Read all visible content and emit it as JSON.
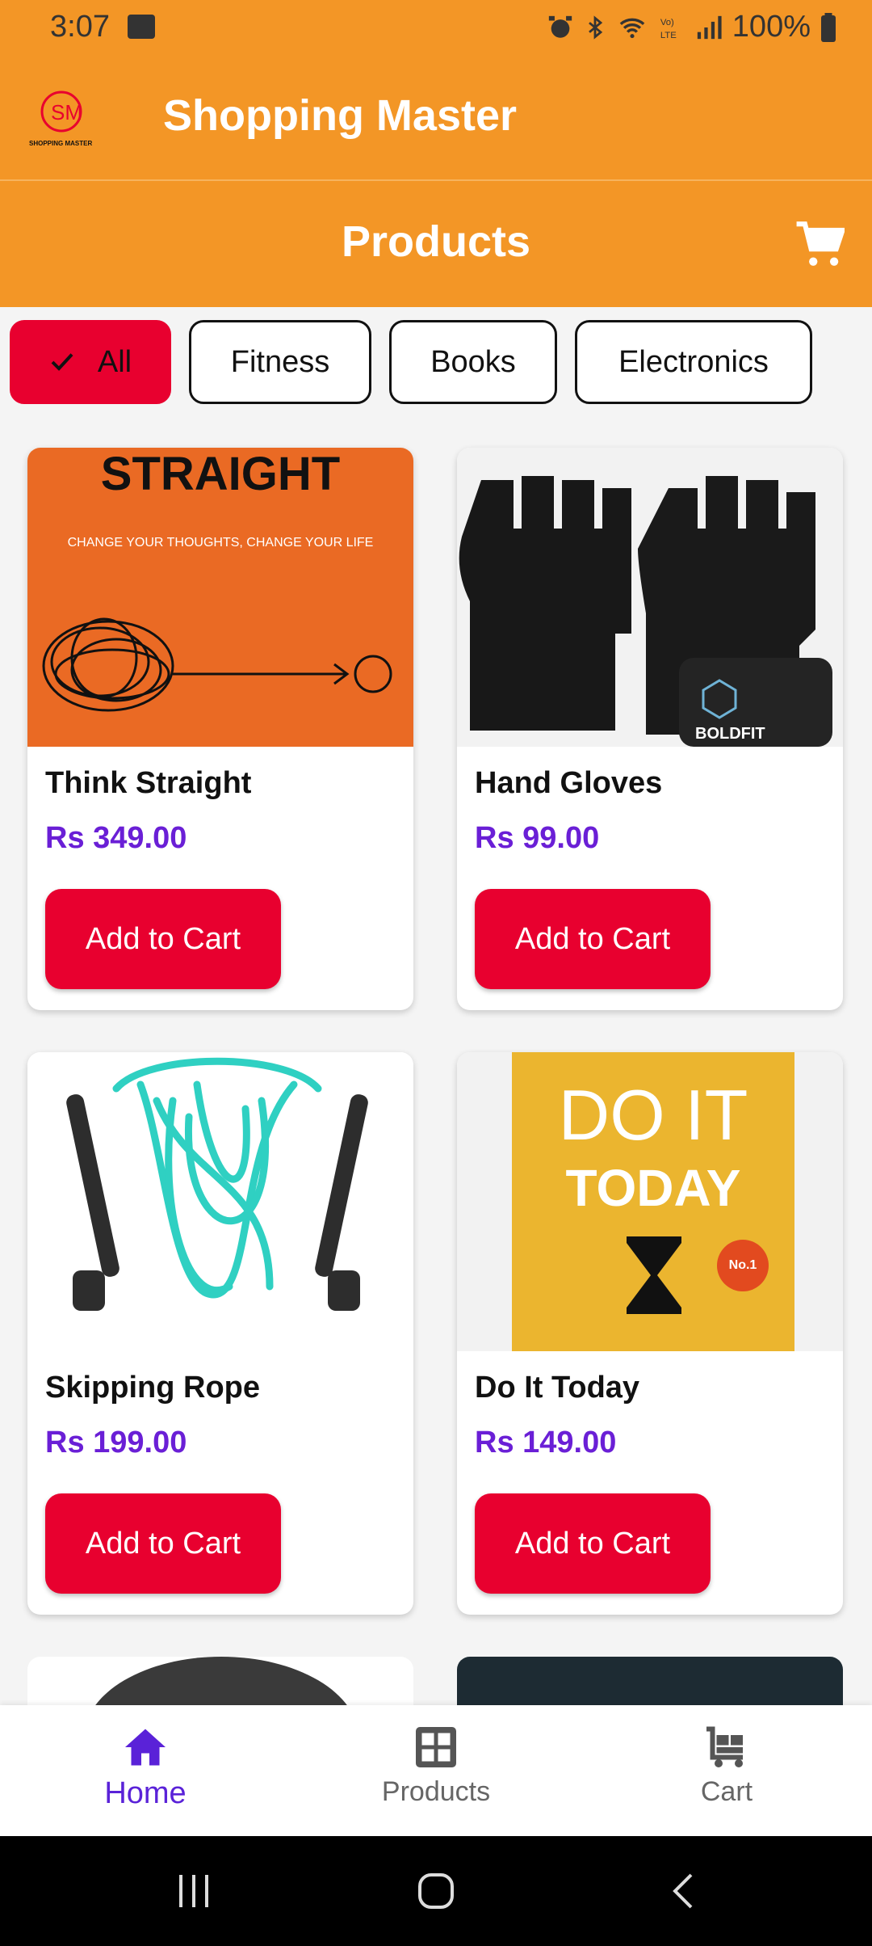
{
  "status_bar": {
    "time": "3:07",
    "battery": "100%"
  },
  "app_bar": {
    "title": "Shopping Master",
    "logo_text": "SHOPPING MASTER"
  },
  "section": {
    "title": "Products"
  },
  "filters": [
    {
      "label": "All",
      "selected": true
    },
    {
      "label": "Fitness",
      "selected": false
    },
    {
      "label": "Books",
      "selected": false
    },
    {
      "label": "Electronics",
      "selected": false
    }
  ],
  "products": [
    {
      "name": "Think Straight",
      "price": "Rs 349.00",
      "button": "Add to Cart",
      "image": "book-think-straight",
      "cover_title": "STRAIGHT",
      "cover_subtitle": "CHANGE YOUR THOUGHTS, CHANGE YOUR LIFE"
    },
    {
      "name": "Hand Gloves",
      "price": "Rs 99.00",
      "button": "Add to Cart",
      "image": "gym-gloves",
      "brand": "BOLDFIT"
    },
    {
      "name": "Skipping Rope",
      "price": "Rs 199.00",
      "button": "Add to Cart",
      "image": "skipping-rope"
    },
    {
      "name": "Do It Today",
      "price": "Rs 149.00",
      "button": "Add to Cart",
      "image": "book-do-it-today",
      "cover_title_1": "DO IT",
      "cover_title_2": "TODAY",
      "badge_text": "No.1"
    }
  ],
  "bottom_nav": [
    {
      "label": "Home",
      "icon": "home-icon",
      "active": true
    },
    {
      "label": "Products",
      "icon": "grid-icon",
      "active": false
    },
    {
      "label": "Cart",
      "icon": "cart-icon",
      "active": false
    }
  ],
  "colors": {
    "primary": "#f39626",
    "accent_red": "#e8002f",
    "price_purple": "#6a1fd6",
    "nav_active": "#5a22d8"
  }
}
